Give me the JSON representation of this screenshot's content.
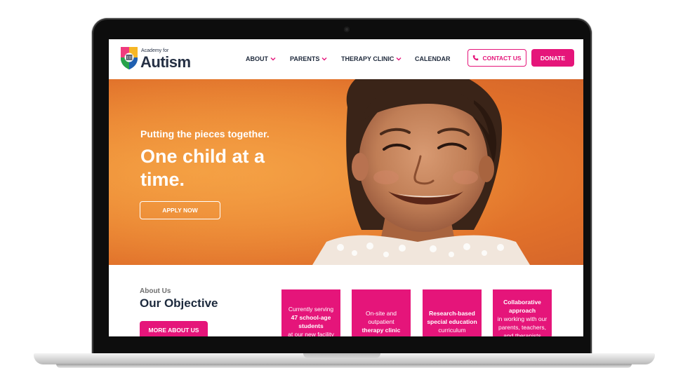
{
  "header": {
    "logo_small": "Academy for",
    "logo_big": "Autism",
    "nav": [
      {
        "label": "ABOUT",
        "has_dropdown": true
      },
      {
        "label": "PARENTS",
        "has_dropdown": true
      },
      {
        "label": "THERAPY CLINIC",
        "has_dropdown": true
      },
      {
        "label": "CALENDAR",
        "has_dropdown": false
      }
    ],
    "contact_label": "CONTACT US",
    "donate_label": "DONATE"
  },
  "hero": {
    "subtitle": "Putting the pieces together.",
    "title": "One child at a time.",
    "apply_label": "APPLY NOW"
  },
  "objective": {
    "section_label": "About Us",
    "title": "Our Objective",
    "more_label": "MORE ABOUT US",
    "cards": [
      {
        "pre": "Currently serving",
        "bold": "47 school-age students",
        "post": "at our new facility"
      },
      {
        "pre": "On-site and outpatient",
        "bold": "therapy clinic",
        "post": ""
      },
      {
        "pre": "",
        "bold": "Research-based special education",
        "post": "curriculum"
      },
      {
        "pre": "",
        "bold": "Collaborative approach",
        "post": "in working with our parents, teachers, and therapists"
      }
    ]
  },
  "colors": {
    "accent": "#e5157a",
    "navy": "#1d2a3d",
    "hero_orange": "#ea8532"
  },
  "icons": {
    "phone": "phone-icon",
    "chevron": "chevron-down-icon",
    "logo": "puzzle-shield-logo"
  }
}
